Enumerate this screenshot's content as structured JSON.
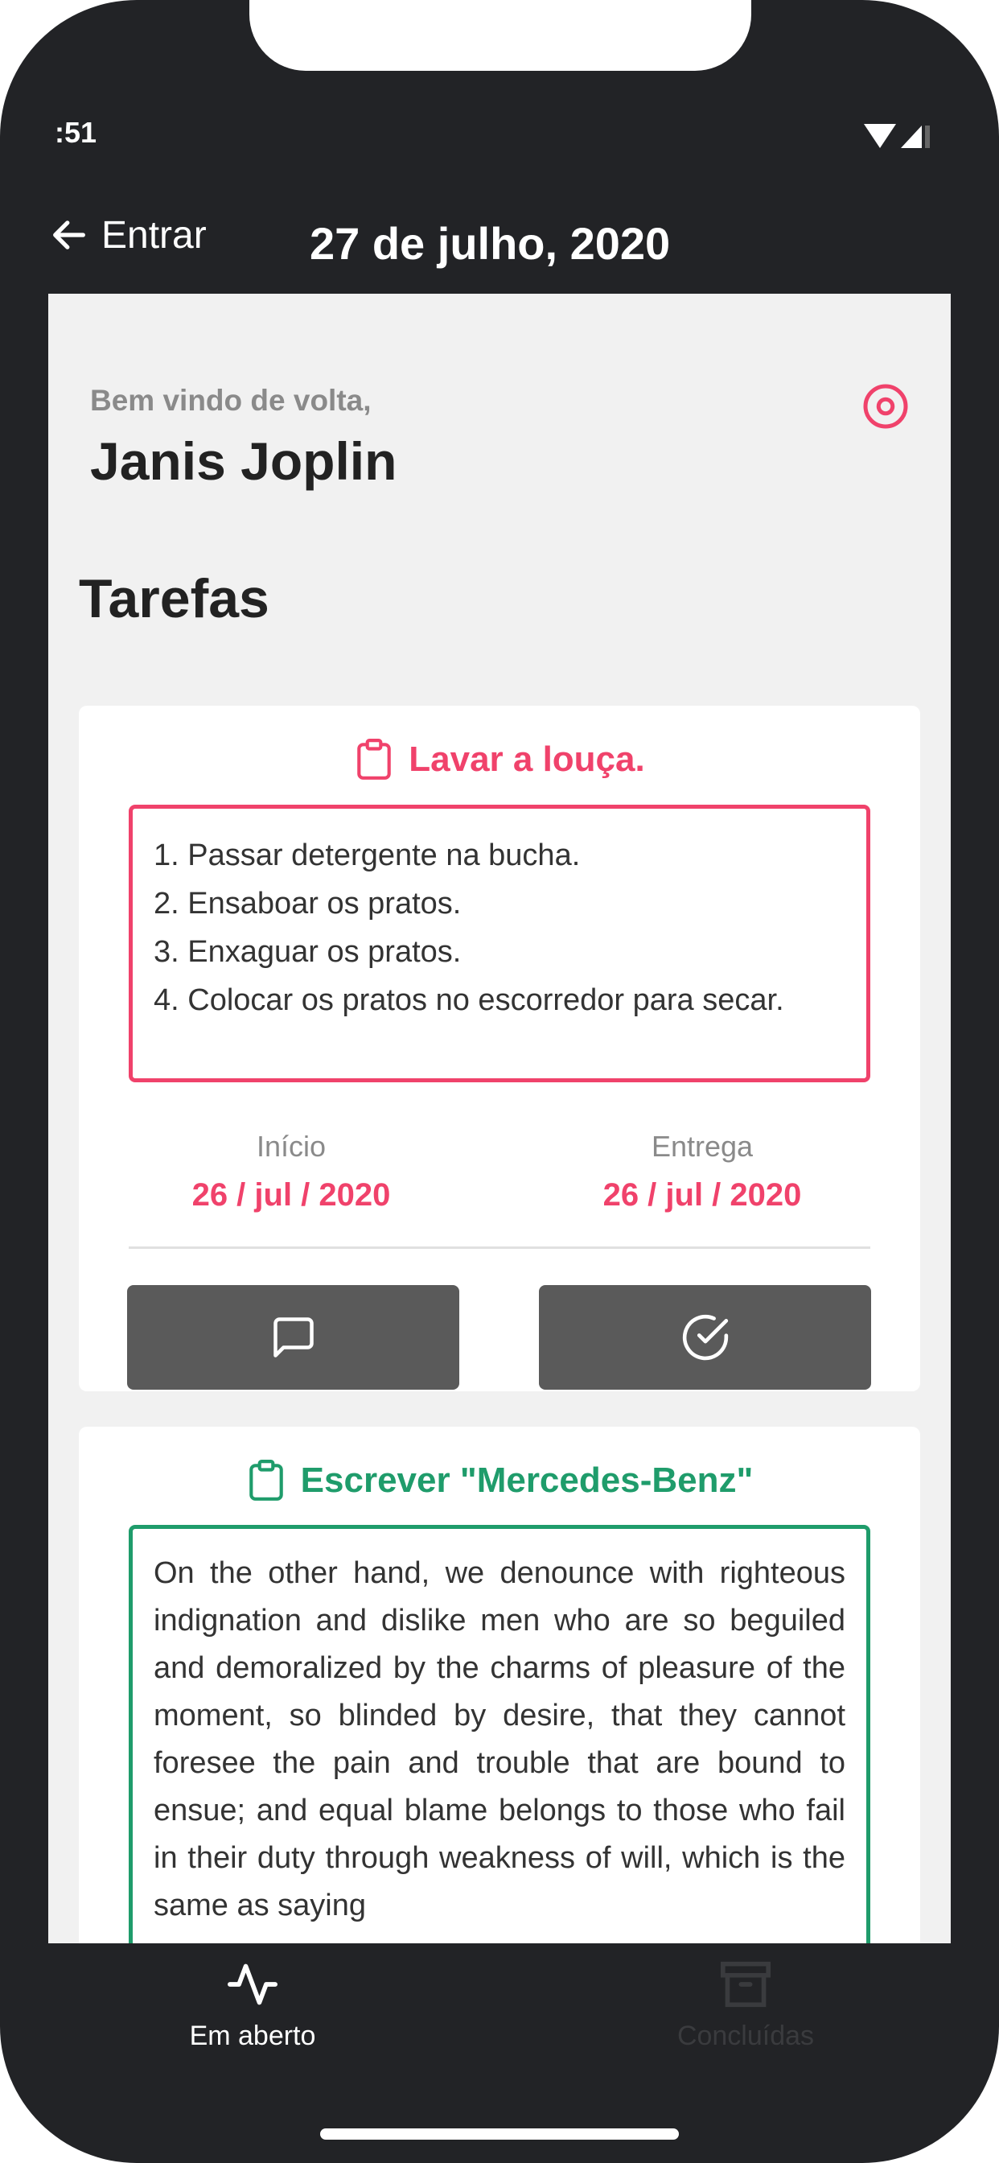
{
  "status_bar": {
    "time": ":51"
  },
  "header": {
    "back_label": "Entrar",
    "title": "27 de julho, 2020"
  },
  "welcome": {
    "greeting": "Bem vindo de volta,",
    "user_name": "Janis Joplin"
  },
  "section_title": "Tarefas",
  "tasks": [
    {
      "title": "Lavar a louça.",
      "color": "#f0426b",
      "steps": [
        "1. Passar detergente na bucha.",
        "2. Ensaboar os pratos.",
        "3. Enxaguar os pratos.",
        "4. Colocar os pratos no escorredor para secar."
      ],
      "start_label": "Início",
      "start_date": "26 / jul / 2020",
      "due_label": "Entrega",
      "due_date": "26 / jul / 2020"
    },
    {
      "title": "Escrever \"Mercedes-Benz\"",
      "color": "#1f9c6b",
      "body": "On the other hand, we denounce with righteous indignation and dislike men who are so beguiled and demoralized by the charms of pleasure of the moment, so blinded by desire, that they cannot foresee the pain and trouble that are bound to ensue; and equal blame belongs to those who fail in their duty through weakness of will, which is the same as saying"
    }
  ],
  "bottom_nav": {
    "open_label": "Em aberto",
    "done_label": "Concluídas"
  },
  "colors": {
    "accent_pink": "#f0426b",
    "accent_green": "#1f9c6b",
    "dark": "#222326",
    "button": "#5a5a5a"
  },
  "icons": {
    "back": "arrow-left-icon",
    "target": "target-icon",
    "clipboard": "clipboard-icon",
    "comment": "message-square-icon",
    "check": "check-circle-icon",
    "activity": "activity-icon",
    "archive": "archive-icon"
  }
}
